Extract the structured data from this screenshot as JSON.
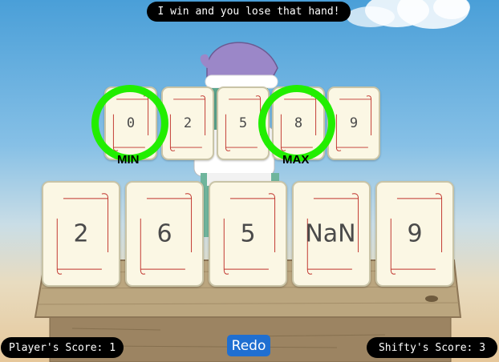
{
  "speech": "I win and you lose that hand!",
  "top_row": [
    {
      "value": "0"
    },
    {
      "value": "2"
    },
    {
      "value": "5"
    },
    {
      "value": "8"
    },
    {
      "value": "9"
    }
  ],
  "labels": {
    "min": "MIN",
    "max": "MAX"
  },
  "bottom_row": [
    {
      "value": "2"
    },
    {
      "value": "6"
    },
    {
      "value": "5"
    },
    {
      "value": "NaN"
    },
    {
      "value": "9"
    }
  ],
  "player_score": "Player's Score: 1",
  "shifty_score": "Shifty's Score: 3",
  "redo_label": "Redo",
  "colors": {
    "ring": "#22ee00",
    "redo": "#1f6fd1",
    "card": "#fbf7e4",
    "flourish": "#c0332c"
  }
}
